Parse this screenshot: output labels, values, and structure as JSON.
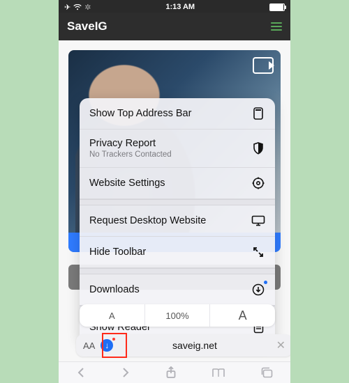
{
  "status": {
    "time": "1:13 AM"
  },
  "site": {
    "brand": "SaveIG"
  },
  "menu": {
    "showAddressBar": "Show Top Address Bar",
    "privacyReport": "Privacy Report",
    "privacySub": "No Trackers Contacted",
    "websiteSettings": "Website Settings",
    "requestDesktop": "Request Desktop Website",
    "hideToolbar": "Hide Toolbar",
    "downloads": "Downloads",
    "showReader": "Show Reader"
  },
  "zoom": {
    "small": "A",
    "level": "100%",
    "large": "A"
  },
  "url": {
    "aa": "AA",
    "host": "saveig.net"
  }
}
